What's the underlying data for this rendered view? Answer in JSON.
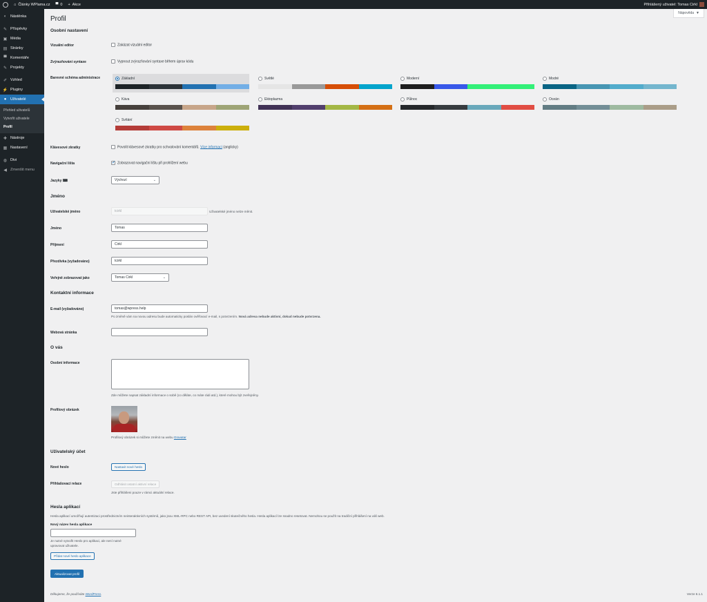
{
  "adminbar": {
    "site_name": "Články WPlama.cz",
    "comments_count": "0",
    "new_label": "Akce",
    "greeting": "Přihlášený uživatel: Tomas Cirkl"
  },
  "sidebar": {
    "items": [
      {
        "label": "Nástěnka",
        "icon": "dashboard-icon"
      },
      {
        "label": "Příspěvky",
        "icon": "pin-icon"
      },
      {
        "label": "Média",
        "icon": "media-icon"
      },
      {
        "label": "Stránky",
        "icon": "page-icon"
      },
      {
        "label": "Komentáře",
        "icon": "comment-icon"
      },
      {
        "label": "Projekty",
        "icon": "pin-icon"
      },
      {
        "label": "Vzhled",
        "icon": "brush-icon"
      },
      {
        "label": "Pluginy",
        "icon": "plug-icon"
      },
      {
        "label": "Uživatelé",
        "icon": "user-icon"
      },
      {
        "label": "Nástroje",
        "icon": "wrench-icon"
      },
      {
        "label": "Nastavení",
        "icon": "settings-icon"
      },
      {
        "label": "Divi",
        "icon": "divi-icon"
      },
      {
        "label": "Zmenšit menu",
        "icon": "collapse-icon"
      }
    ],
    "submenu": [
      "Přehled uživatelů",
      "Vytvořit uživatele",
      "Profil"
    ]
  },
  "screen_options": "Nápověda",
  "page_title": "Profil",
  "personal": {
    "heading": "Osobní nastavení",
    "visual_editor_label": "Vizuální editor",
    "visual_editor_option": "Zakázat vizuální editor",
    "syntax_label": "Zvýrazňování syntaxe",
    "syntax_option": "Vypnout zvýrazňování syntaxe během úprav kódu",
    "scheme_label": "Barevné schéma administrace",
    "schemes": [
      {
        "name": "Základní",
        "colors": [
          "#1d2327",
          "#2c3338",
          "#2271b1",
          "#72aee6"
        ]
      },
      {
        "name": "Světlé",
        "colors": [
          "#e5e5e5",
          "#999999",
          "#d64e07",
          "#04a4cc"
        ]
      },
      {
        "name": "Moderní",
        "colors": [
          "#1e1e1e",
          "#3858e9",
          "#33f078",
          "#33f078"
        ]
      },
      {
        "name": "Modré",
        "colors": [
          "#096484",
          "#4796b3",
          "#52accc",
          "#74b6ce"
        ]
      },
      {
        "name": "Káva",
        "colors": [
          "#46403c",
          "#59524c",
          "#c7a589",
          "#9ea476"
        ]
      },
      {
        "name": "Ektoplazma",
        "colors": [
          "#413256",
          "#523f6d",
          "#a3b745",
          "#d46f15"
        ]
      },
      {
        "name": "Půlnoc",
        "colors": [
          "#25282b",
          "#363b3f",
          "#69a8bb",
          "#e14d43"
        ]
      },
      {
        "name": "Oceán",
        "colors": [
          "#627c83",
          "#738e96",
          "#9ebaa0",
          "#aa9d88"
        ]
      },
      {
        "name": "Svítání",
        "colors": [
          "#b43c38",
          "#cf4944",
          "#dd823b",
          "#ccaf0b"
        ]
      }
    ],
    "shortcuts_label": "Klávesové zkratky",
    "shortcuts_option": "Povolit klávesové zkratky pro schvalování komentářů.",
    "shortcuts_link": "Více informací",
    "shortcuts_suffix": "(anglicky)",
    "toolbar_label": "Navigační lišta",
    "toolbar_option": "Zobrazovat navigační lištu při prohlížení webu",
    "language_label": "Jazyky",
    "language_value": "Výchozí"
  },
  "name": {
    "heading": "Jméno",
    "username_label": "Uživatelské jméno",
    "username_value": "tcirkl",
    "username_note": "Uživatelské jméno nelze měnit.",
    "first_label": "Jméno",
    "first_value": "Tomas",
    "last_label": "Příjmení",
    "last_value": "Cirkl",
    "nick_label": "Přezdívka (vyžadováno)",
    "nick_value": "tcirkl",
    "display_label": "Veřejně zobrazovat jako",
    "display_value": "Tomas Cirkl"
  },
  "contact": {
    "heading": "Kontaktní informace",
    "email_label": "E-mail (vyžadováno)",
    "email_value": "tomas@wpress.help",
    "email_note": "Po změně vám na novou adresu bude automaticky poslán ověřovací e-mail, s potvrzením.",
    "email_note_bold": "Nová adresa nebude aktivní, dokud nebude potvrzena.",
    "website_label": "Webová stránka",
    "website_value": ""
  },
  "about": {
    "heading": "O vás",
    "bio_label": "Osobní informace",
    "bio_note": "Zde můžete napsat základní informace o sobě (co děláte, co máte rádi atd.), které mohou být zveřejněny.",
    "picture_label": "Profilový obrázek",
    "picture_note": "Profilový obrázek si můžete změnit na webu",
    "picture_link": "Gravatar"
  },
  "account": {
    "heading": "Uživatelský účet",
    "password_label": "Nové heslo",
    "password_button": "Nastavit nové heslo",
    "sessions_label": "Přihlašovací relace",
    "sessions_button": "Odhlásit ostatní aktivní relace",
    "sessions_note": "Jste přihlášeni pouze v rámci aktuální relace."
  },
  "app_passwords": {
    "heading": "Hesla aplikací",
    "description": "Hesla aplikací umožňují autentizaci prostřednictvím neinteraktivních systémů, jako jsou XML-RPC nebo REST API, bez uvedení skutečného hesla. Hesla aplikací lze snadno resetovat. Nemohou se použít na tradiční přihlášení na váš web.",
    "name_label": "Nový název hesla aplikace",
    "note_line1": "Je nutné vytvořit Heslo pro aplikaci, ale není nutné",
    "note_line2": "upravovat uživatele.",
    "add_button": "Přidat nové heslo aplikace"
  },
  "submit_button": "Aktualizovat profil",
  "footer": {
    "thanks": "Děkujeme, že používáte",
    "link": "WordPress",
    "version": "Verze 6.1.1"
  }
}
